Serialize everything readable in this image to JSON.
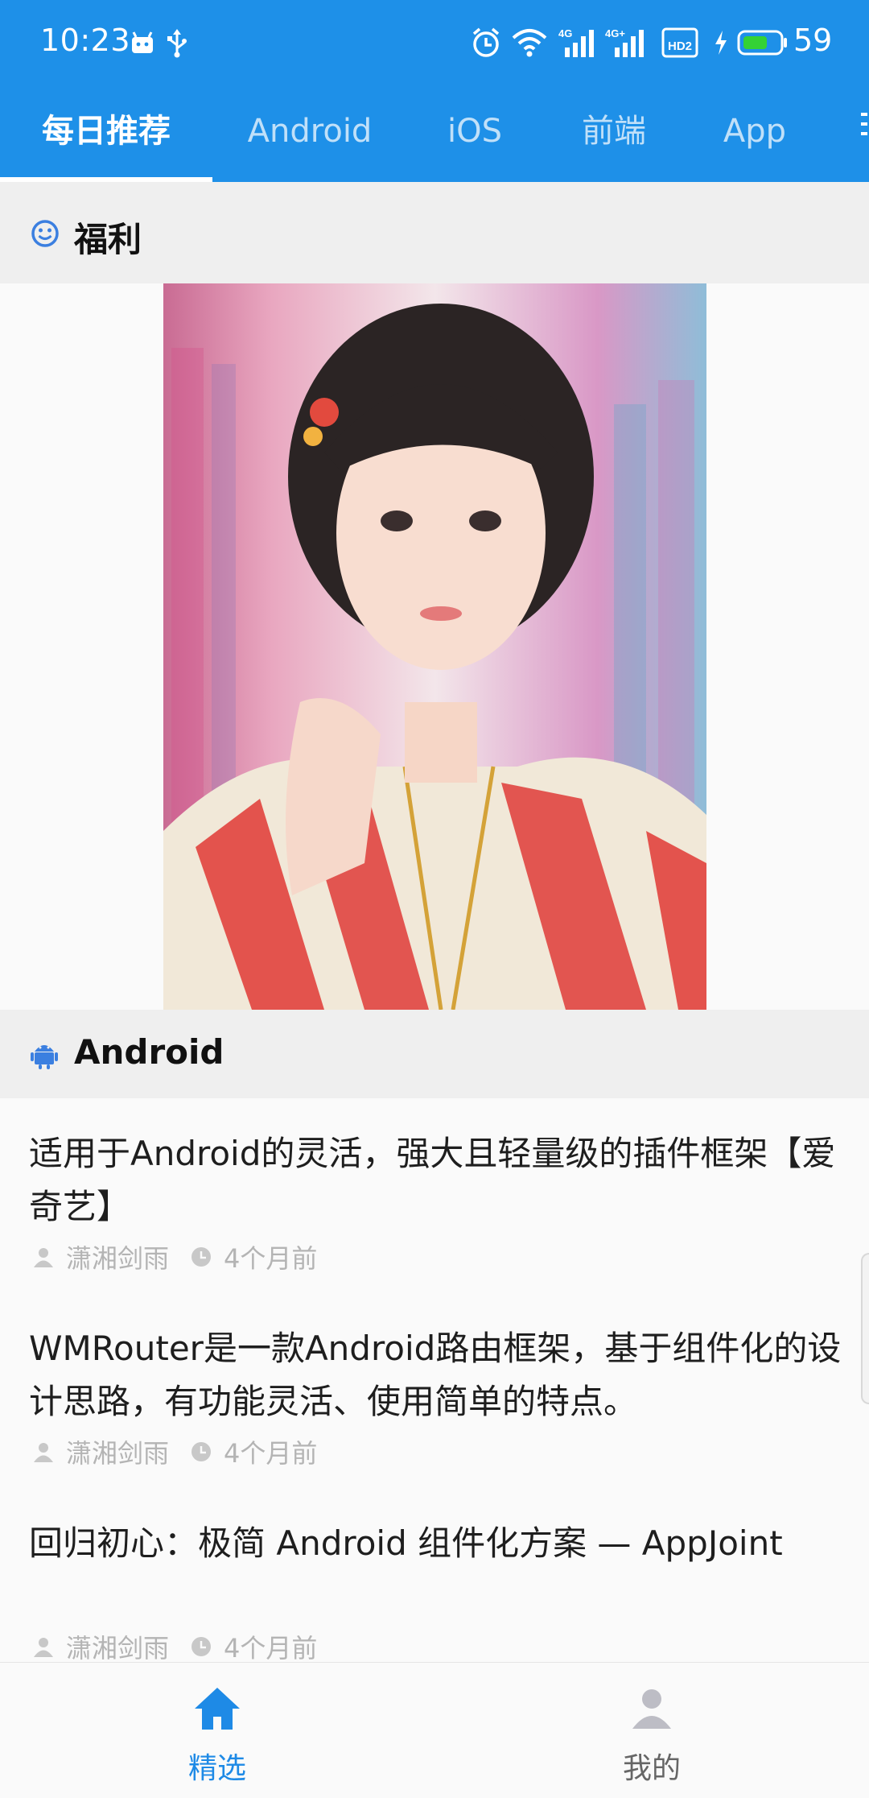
{
  "status_bar": {
    "time": "10:23",
    "network_1": "4G",
    "network_2": "4G+",
    "hd_label": "HD2",
    "battery_percent": "59",
    "icons": [
      "android-notification-icon",
      "usb-icon",
      "alarm-icon",
      "wifi-icon",
      "signal-icon",
      "signal-icon",
      "hd-voice-icon",
      "charging-icon",
      "battery-icon"
    ]
  },
  "tabs": [
    {
      "label": "每日推荐",
      "active": true
    },
    {
      "label": "Android",
      "active": false
    },
    {
      "label": "iOS",
      "active": false
    },
    {
      "label": "前端",
      "active": false
    },
    {
      "label": "App",
      "active": false
    }
  ],
  "sections": {
    "welfare": {
      "label": "福利",
      "icon": "smiley-icon"
    },
    "android": {
      "label": "Android",
      "icon": "android-icon"
    }
  },
  "photo": {
    "alt_icon": "photo"
  },
  "articles": [
    {
      "title": "适用于Android的灵活，强大且轻量级的插件框架【爱奇艺】",
      "author": "潇湘剑雨",
      "time": "4个月前"
    },
    {
      "title": "WMRouter是一款Android路由框架，基于组件化的设计思路，有功能灵活、使用简单的特点。",
      "author": "潇湘剑雨",
      "time": "4个月前"
    },
    {
      "title": "回归初心：极简 Android 组件化方案 — AppJoint",
      "author": "潇湘剑雨",
      "time": "4个月前"
    }
  ],
  "bottom_nav": [
    {
      "label": "精选",
      "icon": "home-icon",
      "active": true
    },
    {
      "label": "我的",
      "icon": "person-icon",
      "active": false
    }
  ],
  "colors": {
    "primary": "#1e90e8",
    "nav_active": "#1e8ae6",
    "nav_inactive": "#777777",
    "meta_gray": "#b4b4b4"
  }
}
